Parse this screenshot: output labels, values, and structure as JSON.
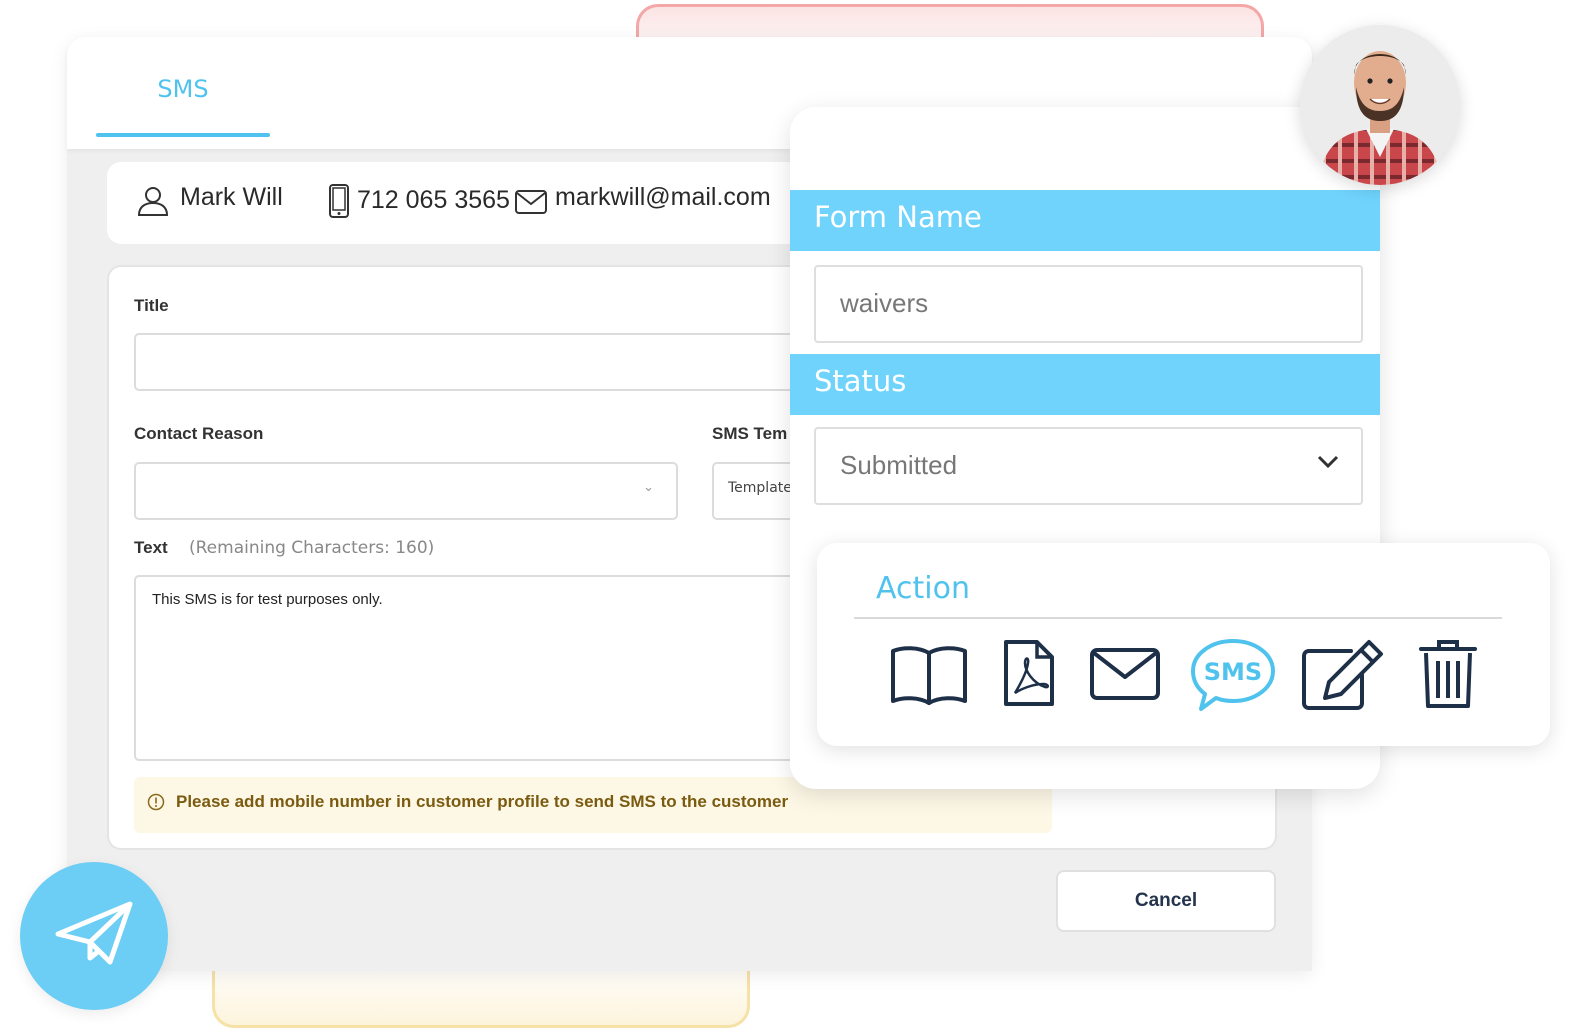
{
  "tabs": {
    "active": "SMS"
  },
  "customer": {
    "name": "Mark Will",
    "phone": "712 065 3565",
    "email": "markwill@mail.com"
  },
  "form": {
    "title_label": "Title",
    "title_value": "",
    "contact_reason_label": "Contact Reason",
    "sms_template_label": "SMS Tem",
    "template_placeholder": "Template",
    "text_label": "Text",
    "remaining": "(Remaining Characters: 160)",
    "text_value": "This SMS is for test purposes only.",
    "warning": "Please add mobile number in customer profile to send SMS to the customer",
    "cancel_label": "Cancel"
  },
  "form_panel": {
    "form_name_label": "Form Name",
    "form_name_value": "waivers",
    "status_label": "Status",
    "status_value": "Submitted"
  },
  "action": {
    "title": "Action",
    "icons": [
      "book-icon",
      "pdf-icon",
      "mail-icon",
      "sms-bubble-icon",
      "edit-icon",
      "trash-icon"
    ],
    "sms_icon_text": "SMS"
  },
  "colors": {
    "accent": "#4fc3ee",
    "header_band": "#6fd3fb",
    "navy": "#24344c",
    "warning_bg": "#fdf7e6",
    "warning_text": "#7a5b10"
  }
}
